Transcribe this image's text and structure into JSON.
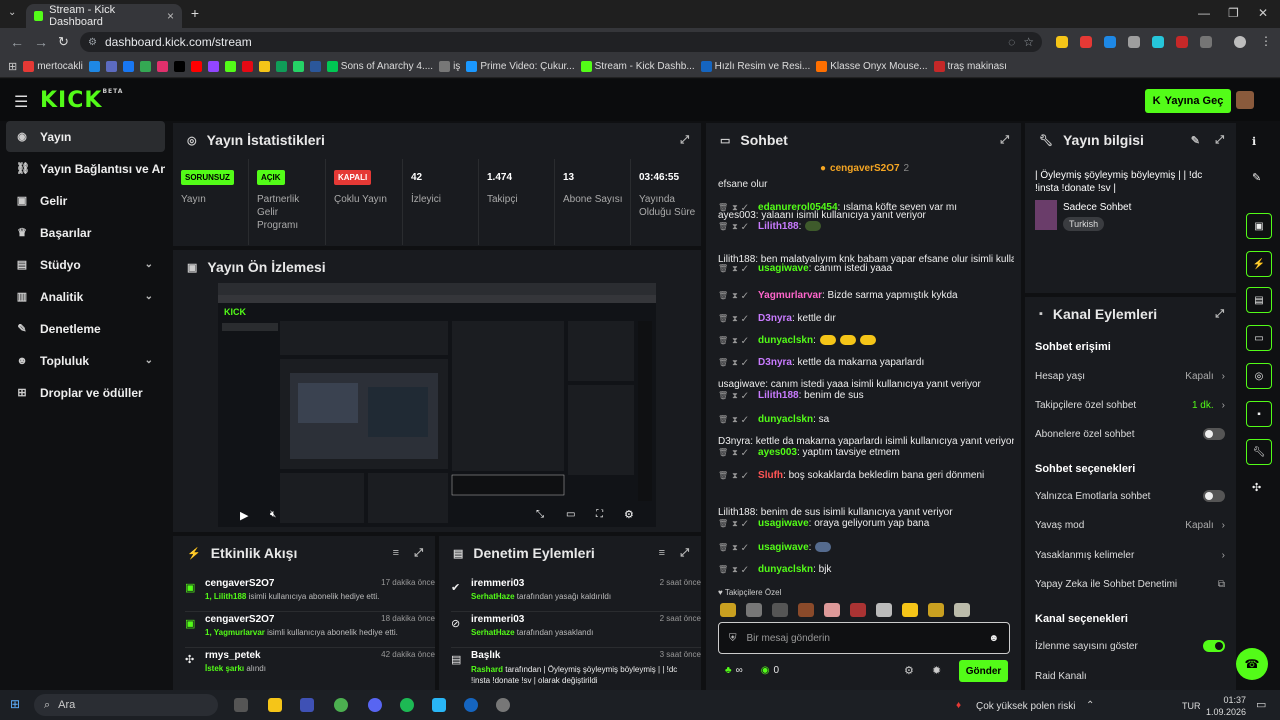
{
  "browser": {
    "tab_title": "Stream - Kick Dashboard",
    "url": "dashboard.kick.com/stream",
    "bookmarks": [
      {
        "label": "mertocakli",
        "color": "#e53935"
      },
      {
        "label": "",
        "color": "#1e88e5"
      },
      {
        "label": "",
        "color": "#5c6bc0"
      },
      {
        "label": "",
        "color": "#1877f2"
      },
      {
        "label": "",
        "color": "#34a853"
      },
      {
        "label": "",
        "color": "#e1306c"
      },
      {
        "label": "",
        "color": "#000000"
      },
      {
        "label": "",
        "color": "#ff0000"
      },
      {
        "label": "",
        "color": "#9146ff"
      },
      {
        "label": "",
        "color": "#53fc18"
      },
      {
        "label": "",
        "color": "#e50914"
      },
      {
        "label": "",
        "color": "#f5c518"
      },
      {
        "label": "",
        "color": "#0f9d58"
      },
      {
        "label": "",
        "color": "#25d366"
      },
      {
        "label": "",
        "color": "#2b579a"
      },
      {
        "label": "Sons of Anarchy 4....",
        "color": "#00c853"
      },
      {
        "label": "iş",
        "color": "#777777"
      },
      {
        "label": "Prime Video: Çukur...",
        "color": "#1a98ff"
      },
      {
        "label": "Stream - Kick Dashb...",
        "color": "#53fc18"
      },
      {
        "label": "Hızlı Resim ve Resi...",
        "color": "#1565c0"
      },
      {
        "label": "Klasse Onyx Mouse...",
        "color": "#ff6f00"
      },
      {
        "label": "traş makinası",
        "color": "#c62828"
      }
    ]
  },
  "header": {
    "logo": "KICK",
    "logo_beta": "BETA",
    "go_live": "Yayına Geç"
  },
  "sidebar": {
    "items": [
      {
        "label": "Yayın",
        "icon": "broadcast-icon",
        "glyph": "◉",
        "active": true,
        "chev": false
      },
      {
        "label": "Yayın Bağlantısı ve Anahtar",
        "icon": "link-icon",
        "glyph": "⛓",
        "active": false,
        "chev": false
      },
      {
        "label": "Gelir",
        "icon": "revenue-icon",
        "glyph": "▣",
        "active": false,
        "chev": false
      },
      {
        "label": "Başarılar",
        "icon": "trophy-icon",
        "glyph": "♛",
        "active": false,
        "chev": false
      },
      {
        "label": "Stüdyo",
        "icon": "studio-icon",
        "glyph": "▤",
        "active": false,
        "chev": true
      },
      {
        "label": "Analitik",
        "icon": "analytics-icon",
        "glyph": "▥",
        "active": false,
        "chev": true
      },
      {
        "label": "Denetleme",
        "icon": "hammer-icon",
        "glyph": "✎",
        "active": false,
        "chev": false
      },
      {
        "label": "Topluluk",
        "icon": "community-icon",
        "glyph": "☻",
        "active": false,
        "chev": true
      },
      {
        "label": "Droplar ve ödüller",
        "icon": "gift-icon",
        "glyph": "⊞",
        "active": false,
        "chev": false
      }
    ]
  },
  "stats": {
    "title": "Yayın İstatistikleri",
    "columns": [
      {
        "badge": "SORUNSUZ",
        "badge_color": "#53fc18",
        "badge_text": "#000000",
        "value": "",
        "label": "Yayın"
      },
      {
        "badge": "AÇIK",
        "badge_color": "#53fc18",
        "badge_text": "#000000",
        "value": "",
        "label": "Partnerlik Gelir Programı"
      },
      {
        "badge": "KAPALI",
        "badge_color": "#e53935",
        "badge_text": "#ffffff",
        "value": "",
        "label": "Çoklu Yayın"
      },
      {
        "badge": "",
        "value": "42",
        "label": "İzleyici"
      },
      {
        "badge": "",
        "value": "1.474",
        "label": "Takipçi"
      },
      {
        "badge": "",
        "value": "13",
        "label": "Abone Sayısı"
      },
      {
        "badge": "",
        "value": "03:46:55",
        "label": "Yayında Olduğu Süre"
      }
    ]
  },
  "preview": {
    "title": "Yayın Ön İzlemesi"
  },
  "activity": {
    "title": "Etkinlik Akışı",
    "items": [
      {
        "name": "cengaverS2O7",
        "time": "17 dakika önce",
        "prefix": "1, ",
        "highlight": "Lilith188",
        "desc": " isimli kullanıcıya abonelik hediye etti.",
        "icon": "gift-sub-icon"
      },
      {
        "name": "cengaverS2O7",
        "time": "18 dakika önce",
        "prefix": "1, ",
        "highlight": "Yagmurlarvar",
        "desc": " isimli kullanıcıya abonelik hediye etti.",
        "icon": "gift-sub-icon"
      },
      {
        "name": "rmys_petek",
        "time": "42 dakika önce",
        "prefix": "",
        "highlight": "İstek şarkı",
        "desc": " alındı",
        "icon": "song-request-icon"
      }
    ]
  },
  "moderation": {
    "title": "Denetim Eylemleri",
    "items": [
      {
        "name": "iremmeri03",
        "time": "2 saat önce",
        "highlight": "SerhatHaze",
        "desc": " tarafından yasağı kaldırıldı",
        "icon": "check-circle-icon"
      },
      {
        "name": "iremmeri03",
        "time": "2 saat önce",
        "highlight": "SerhatHaze",
        "desc": " tarafından yasaklandı",
        "icon": "ban-icon"
      },
      {
        "name": "Başlık",
        "time": "3 saat önce",
        "highlight": "Rashard",
        "desc": " tarafından | Öyleymiş şöyleymiş böyleymiş | | !dc !insta !donate !sv | olarak değiştirildi",
        "icon": "title-icon"
      }
    ]
  },
  "chat": {
    "title": "Sohbet",
    "pinned_user": "cengaverS2O7",
    "pinned_count": "2",
    "first_line": "efsane olur",
    "messages": [
      {
        "user": "edanurerol05454",
        "color": "#53fc18",
        "text": ": ıslama köfte seven var mı",
        "reply": ""
      },
      {
        "user": "Lilith188",
        "color": "#c97bff",
        "text": ":",
        "reply": "ayes003: yalaanı isimli kullanıcıya yanıt veriyor"
      },
      {
        "user": "usagiwave",
        "color": "#53fc18",
        "text": ": canım istedi yaaa",
        "reply": "Lilith188: ben malatyalıyım knk babam yapar efsane olur isimli kullanıc..."
      },
      {
        "user": "Yagmurlarvar",
        "color": "#ff66cc",
        "text": ": Bizde sarma yapmıştık kykda",
        "reply": ""
      },
      {
        "user": "D3nyra",
        "color": "#c97bff",
        "text": ": kettle dır",
        "reply": ""
      },
      {
        "user": "dunyaclskn",
        "color": "#53fc18",
        "text": ":",
        "reply": ""
      },
      {
        "user": "D3nyra",
        "color": "#c97bff",
        "text": ": kettle da makarna yaparlardı",
        "reply": ""
      },
      {
        "user": "Lilith188",
        "color": "#c97bff",
        "text": ": benim de sus",
        "reply": "usagiwave: canım istedi yaaa isimli kullanıcıya yanıt veriyor"
      },
      {
        "user": "dunyaclskn",
        "color": "#53fc18",
        "text": ": sa",
        "reply": ""
      },
      {
        "user": "ayes003",
        "color": "#53fc18",
        "text": ": yaptım tavsiye etmem",
        "reply": "D3nyra: kettle da makarna yaparlardı isimli kullanıcıya yanıt veriyor"
      },
      {
        "user": "Slufh",
        "color": "#ff5555",
        "text": ": boş sokaklarda bekledim bana geri dönmeni",
        "reply": ""
      },
      {
        "user": "usagiwave",
        "color": "#53fc18",
        "text": ": oraya geliyorum yap bana",
        "reply": "Lilith188: benim de sus isimli kullanıcıya yanıt veriyor"
      },
      {
        "user": "usagiwave",
        "color": "#53fc18",
        "text": ":",
        "reply": ""
      },
      {
        "user": "dunyaclskn",
        "color": "#53fc18",
        "text": ": bjk",
        "reply": ""
      }
    ],
    "emote_label": "Takipçilere Özel",
    "input_placeholder": "Bir mesaj gönderin",
    "points_a": "∞",
    "points_b": "0",
    "send": "Gönder"
  },
  "info": {
    "title": "Yayın bilgisi",
    "stream_title": "| Öyleymiş şöyleymiş böyleymiş | | !dc !insta !donate !sv |",
    "category": "Sadece Sohbet",
    "tag": "Turkish"
  },
  "actions": {
    "title": "Kanal Eylemleri",
    "sec1": "Sohbet erişimi",
    "r1": {
      "label": "Hesap yaşı",
      "value": "Kapalı"
    },
    "r2": {
      "label": "Takipçilere özel sohbet",
      "value": "1 dk."
    },
    "r3": {
      "label": "Abonelere özel sohbet"
    },
    "sec2": "Sohbet seçenekleri",
    "r4": {
      "label": "Yalnızca Emotlarla sohbet"
    },
    "r5": {
      "label": "Yavaş mod",
      "value": "Kapalı"
    },
    "r6": {
      "label": "Yasaklanmış kelimeler"
    },
    "r7": {
      "label": "Yapay Zeka ile Sohbet Denetimi"
    },
    "sec3": "Kanal seçenekleri",
    "r8": {
      "label": "İzlenme sayısını göster"
    },
    "r9": {
      "label": "Raid Kanalı"
    }
  },
  "taskbar": {
    "search": "Ara",
    "weather": "Çok yüksek polen riski",
    "lang": "TUR",
    "time": "01:37",
    "date": "1.09.2026"
  }
}
